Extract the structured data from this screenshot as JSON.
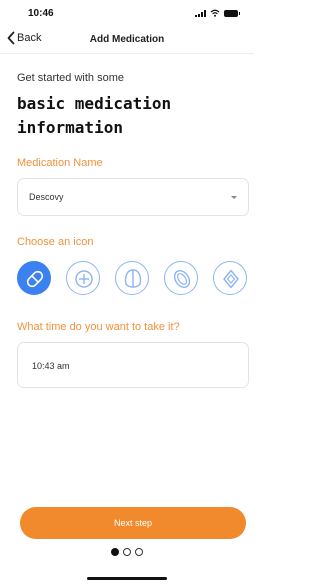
{
  "status_bar": {
    "time": "10:46"
  },
  "nav": {
    "back_label": "Back",
    "title": "Add Medication"
  },
  "intro": {
    "text": "Get started with some",
    "heading": "basic medication information"
  },
  "medication_name": {
    "label": "Medication Name",
    "value": "Descovy"
  },
  "icon_picker": {
    "label": "Choose an icon",
    "options": [
      {
        "icon": "pill-capsule-icon",
        "selected": true
      },
      {
        "icon": "plus-pill-icon",
        "selected": false
      },
      {
        "icon": "split-tablet-icon",
        "selected": false
      },
      {
        "icon": "oval-pill-icon",
        "selected": false
      },
      {
        "icon": "diamond-tablet-icon",
        "selected": false
      }
    ]
  },
  "time_picker": {
    "label": "What time do you want to take it?",
    "value": "10:43 am"
  },
  "footer": {
    "next_label": "Next step",
    "pager_total": 3,
    "pager_active": 1
  },
  "colors": {
    "accent_orange": "#f08a2d",
    "label_orange": "#f0923d",
    "accent_blue": "#3b82f0",
    "icon_outline_blue": "#8fb4f4"
  }
}
